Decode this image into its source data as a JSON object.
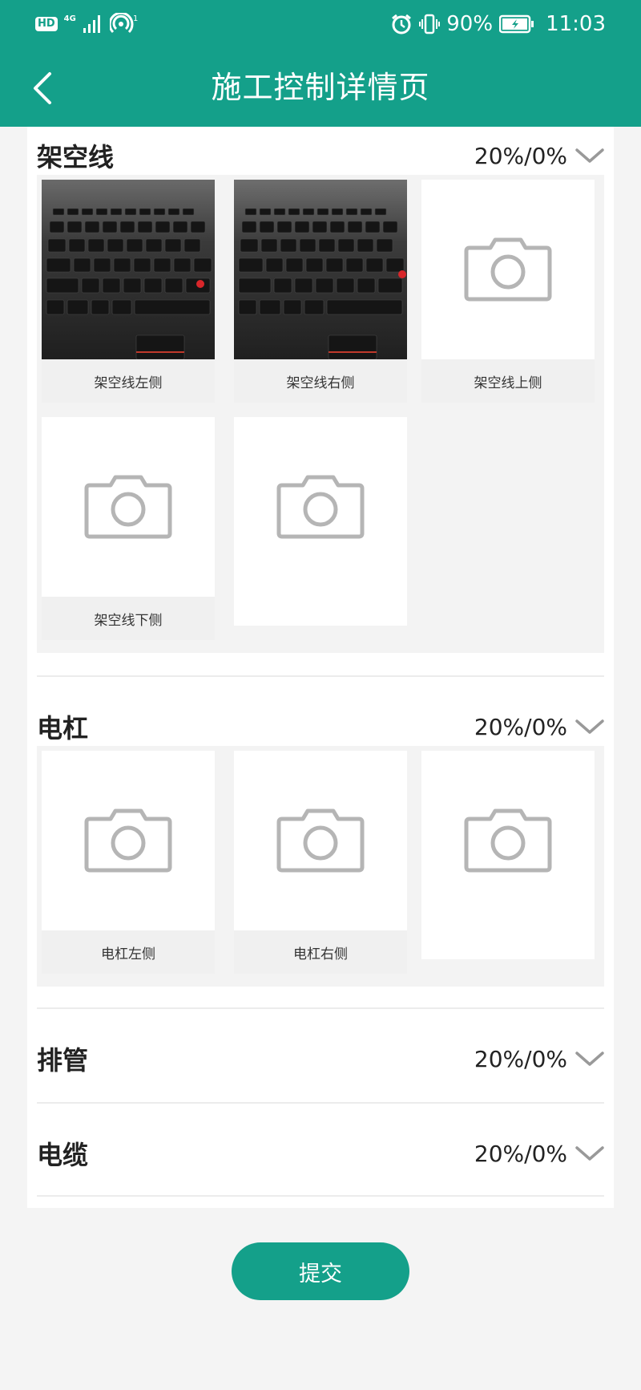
{
  "status_bar": {
    "hd_badge": "HD",
    "network_type": "4G",
    "battery": "90%",
    "time": "11:03",
    "icons": [
      "signal-icon",
      "hotspot-icon",
      "alarm-icon",
      "vibrate-icon",
      "battery-icon"
    ]
  },
  "header": {
    "title": "施工控制详情页",
    "back_icon": "chevron-left-icon",
    "background": "#14a08a"
  },
  "sections": [
    {
      "title": "架空线",
      "progress": "20%/0%",
      "expanded": true,
      "photos": [
        {
          "caption": "架空线左侧",
          "has_photo": true
        },
        {
          "caption": "架空线右侧",
          "has_photo": true
        },
        {
          "caption": "架空线上侧",
          "has_photo": false
        },
        {
          "caption": "架空线下侧",
          "has_photo": false
        },
        {
          "caption": "",
          "has_photo": false
        }
      ]
    },
    {
      "title": "电杠",
      "progress": "20%/0%",
      "expanded": true,
      "photos": [
        {
          "caption": "电杠左侧",
          "has_photo": false
        },
        {
          "caption": "电杠右侧",
          "has_photo": false
        },
        {
          "caption": "",
          "has_photo": false
        }
      ]
    },
    {
      "title": "排管",
      "progress": "20%/0%",
      "expanded": false
    },
    {
      "title": "电缆",
      "progress": "20%/0%",
      "expanded": false
    }
  ],
  "submit_label": "提交"
}
